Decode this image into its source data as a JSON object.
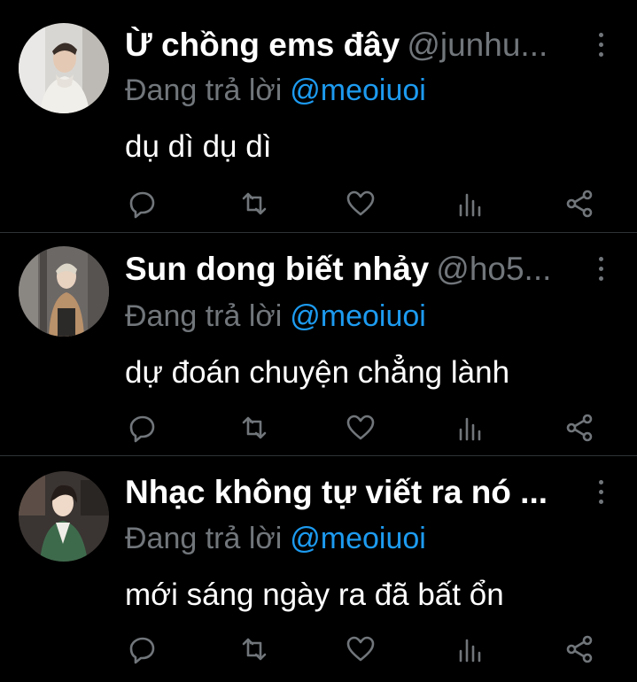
{
  "tweets": [
    {
      "display_name": "Ừ chồng ems đây",
      "handle": "@junhu...",
      "reply_prefix": "Đang trả lời",
      "reply_to": "@meoiuoi",
      "text": "dụ dì dụ dì",
      "avatar_icon": "user-avatar-photo"
    },
    {
      "display_name": "Sun dong biết nhảy",
      "handle": "@ho5...",
      "reply_prefix": "Đang trả lời",
      "reply_to": "@meoiuoi",
      "text": "dự đoán chuyện chẳng lành",
      "avatar_icon": "user-avatar-photo"
    },
    {
      "display_name": "Nhạc không tự viết ra nó ...",
      "handle": "",
      "reply_prefix": "Đang trả lời",
      "reply_to": "@meoiuoi",
      "text": "mới sáng ngày ra đã bất ổn",
      "avatar_icon": "user-avatar-photo"
    }
  ],
  "icons": {
    "reply": "reply-icon",
    "retweet": "retweet-icon",
    "like": "heart-icon",
    "views": "views-icon",
    "share": "share-icon",
    "more": "more-vertical-icon"
  },
  "colors": {
    "background": "#000000",
    "name": "#ffffff",
    "secondary": "#71767b",
    "mention": "#1d9bf0",
    "divider": "#2f3336"
  }
}
